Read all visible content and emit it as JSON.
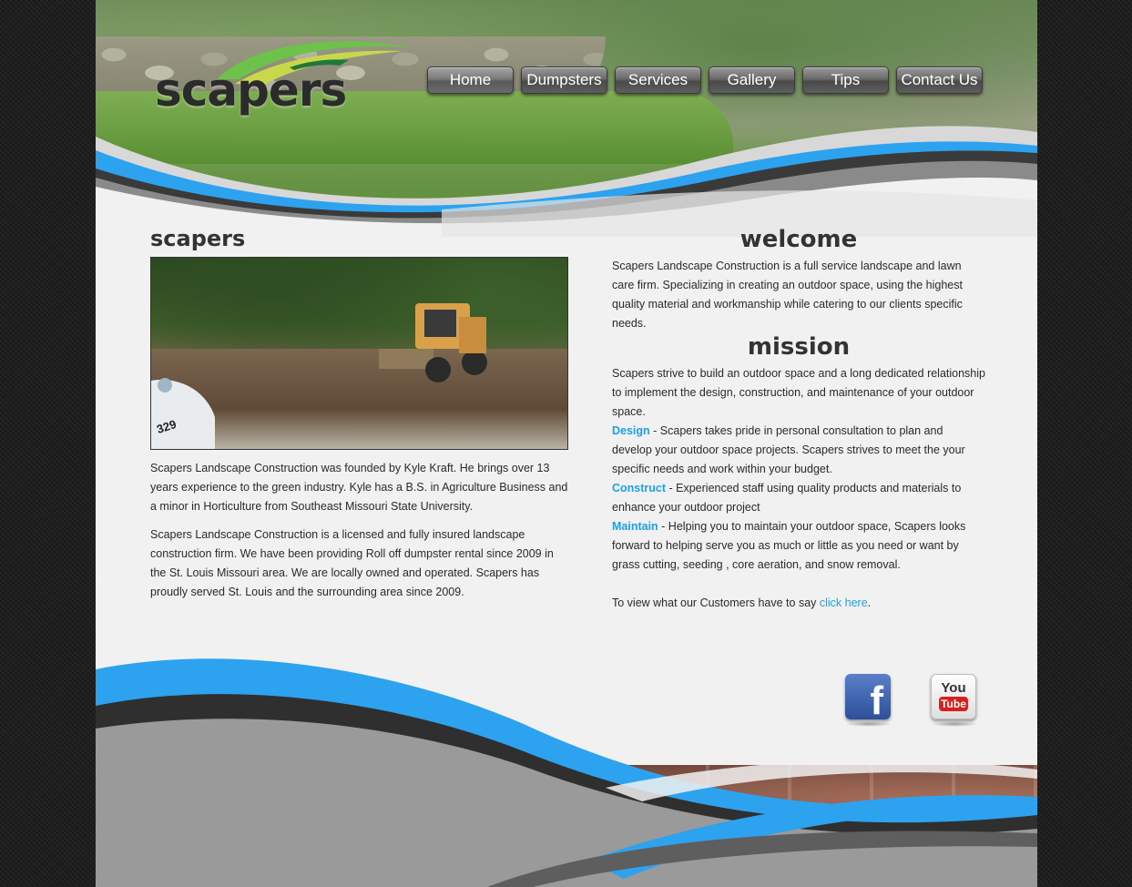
{
  "logo": {
    "text": "scapers"
  },
  "nav": {
    "items": [
      {
        "label": "Home"
      },
      {
        "label": "Dumpsters"
      },
      {
        "label": "Services"
      },
      {
        "label": "Gallery"
      },
      {
        "label": "Tips"
      },
      {
        "label": "Contact Us"
      }
    ]
  },
  "left": {
    "title": "scapers",
    "photo_text": "329",
    "para1": "Scapers Landscape Construction was founded by Kyle Kraft. He brings over 13 years experience to the green industry. Kyle has a B.S. in Agriculture Business and a minor in Horticulture from Southeast Missouri State University.",
    "para2": "Scapers Landscape Construction is a licensed and fully insured landscape construction firm. We have been providing Roll off dumpster rental since 2009 in the St. Louis Missouri area. We are locally owned and operated. Scapers has proudly served St. Louis and the surrounding area since 2009."
  },
  "right": {
    "welcome_title": "welcome",
    "welcome_text": "Scapers Landscape Construction is a full service landscape and lawn care firm. Specializing in creating an outdoor space, using the highest quality material and workmanship while catering to our clients specific needs.",
    "mission_title": "mission",
    "mission_text": "Scapers strive to build an outdoor space and a long dedicated relationship to implement the design, construction, and maintenance of your outdoor space.",
    "design_label": "Design",
    "design_text": " - Scapers takes pride in personal consultation to plan and develop your outdoor space projects. Scapers strives to meet the your specific needs and work within your budget.",
    "construct_label": "Construct",
    "construct_text": " - Experienced staff using quality products and materials to enhance your outdoor project",
    "maintain_label": "Maintain",
    "maintain_text": " - Helping you to maintain your outdoor space, Scapers looks forward to helping serve you as much or little as you need or want by grass cutting, seeding , core aeration, and snow removal.",
    "customers_text": "To view what our Customers have to say ",
    "customers_link": "click here",
    "customers_end": "."
  },
  "social": {
    "facebook_glyph": "f",
    "youtube_top": "You",
    "youtube_bottom": "Tube"
  },
  "colors": {
    "accent": "#1ea0e6",
    "page_bg": "#f1f1f1",
    "text": "#2a2a2a"
  }
}
